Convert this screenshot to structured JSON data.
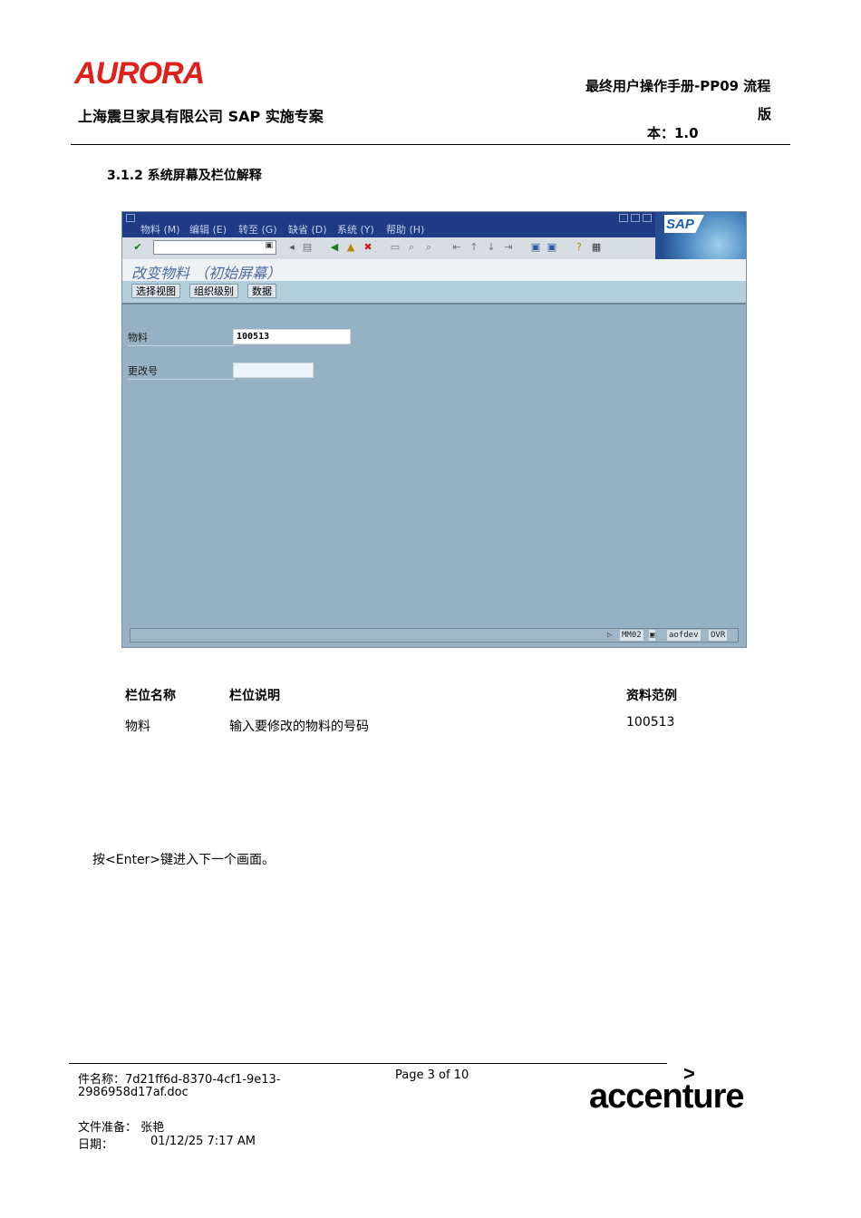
{
  "header": {
    "logo_text": "AURORA",
    "company": "上海震旦家具有限公司 SAP 实施专案",
    "manual_title": "最终用户操作手册-PP09 流程",
    "manual_ban": "版",
    "manual_version": "本：1.0"
  },
  "section_heading": "3.1.2 系统屏幕及栏位解释",
  "sap_window": {
    "menu": [
      "物料 (M)",
      "编辑 (E)",
      "转至 (G)",
      "缺省 (D)",
      "系统 (Y)",
      "帮助 (H)"
    ],
    "logo": "SAP",
    "screen_title": "改变物料 （初始屏幕）",
    "app_buttons": [
      "选择视图",
      "组织级别",
      "数据"
    ],
    "fields": {
      "material_label": "物料",
      "material_value": "100513",
      "change_label": "更改号",
      "change_value": ""
    },
    "status": {
      "transaction": "MM02",
      "server": "aofdev",
      "mode": "OVR"
    },
    "icons": [
      "enter-icon",
      "back-icon",
      "exit-icon",
      "cancel-icon",
      "save-icon",
      "print-icon",
      "find-icon",
      "help-icon",
      "layout-icon"
    ]
  },
  "field_table": {
    "headers": [
      "栏位名称",
      "栏位说明",
      "资料范例"
    ],
    "rows": [
      [
        "物料",
        "输入要修改的物料的号码",
        "100513"
      ]
    ]
  },
  "instruction": "按<Enter>键进入下一个画面。",
  "footer": {
    "filename_line1": "件名称：7d21ff6d-8370-4cf1-9e13-",
    "filename_line2": "2986958d17af.doc",
    "page": "Page 3 of 10",
    "prepared_by": "文件准备：  张艳",
    "date_label": "日期：",
    "date_value": "01/12/25 7:17 AM",
    "brand": "accenture",
    "brand_mark": ">"
  }
}
